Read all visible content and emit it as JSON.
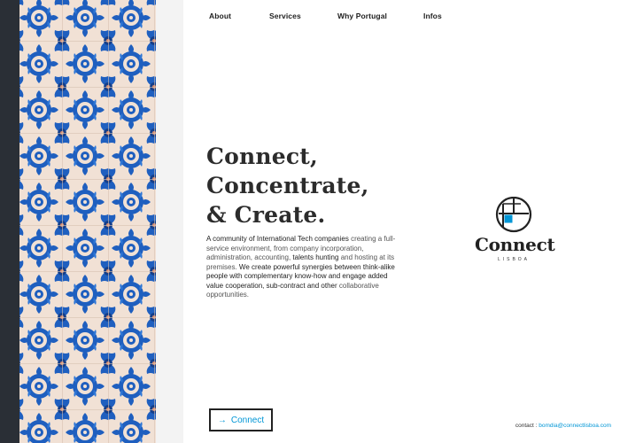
{
  "nav": {
    "items": [
      {
        "label": "About"
      },
      {
        "label": "Services"
      },
      {
        "label": "Why Portugal"
      },
      {
        "label": "Infos"
      }
    ]
  },
  "hero": {
    "line1": "Connect,",
    "line2": "Concentrate,",
    "line3": "& Create."
  },
  "description": {
    "seg1": "A community of International Tech companies",
    "seg2": "creating a full-service environment, from company incorporation, administration, accounting,",
    "seg3": "talents hunting",
    "seg4": "and hosting at its premises.",
    "seg5": "We create powerful synergies between think-alike people with complementary know-how and engage added value cooperation, sub-contract and other",
    "seg6": "collaborative opportunities."
  },
  "logo": {
    "word": "Connect",
    "sub": "LISBOA",
    "colors": {
      "ink": "#222222",
      "accent": "#0096d6"
    }
  },
  "cta": {
    "arrow": "→",
    "label": "Connect"
  },
  "contact": {
    "label": "contact :",
    "email": "bomdia@connectlisboa.com"
  },
  "colors": {
    "tile_blue": "#1f5fbf",
    "tile_cream": "#f1e1d5",
    "link_blue": "#0096d6",
    "dark_strip": "#2a2f36"
  }
}
